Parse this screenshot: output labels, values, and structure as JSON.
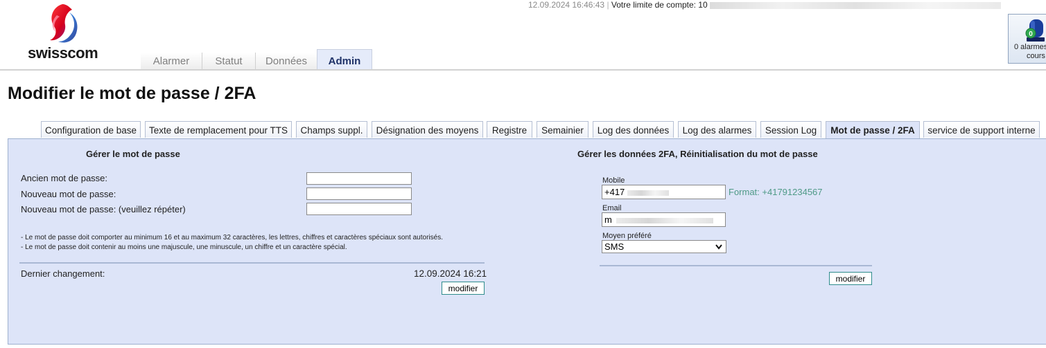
{
  "brand": {
    "name": "swisscom",
    "colors": {
      "red": "#e4003a",
      "blue": "#1f5eb5",
      "accent": "#1f3268"
    }
  },
  "topbar": {
    "datetime": "12.09.2024 16:46:43",
    "limit_label": "Votre limite de compte: 10"
  },
  "alarm_widget": {
    "count": "0",
    "label_line1": "0 alarmes",
    "label_line2": "cours",
    "icon": "alarm-beacon-icon"
  },
  "main_tabs": [
    {
      "label": "Alarmer"
    },
    {
      "label": "Statut"
    },
    {
      "label": "Données"
    },
    {
      "label": "Admin"
    }
  ],
  "active_main_tab": "Admin",
  "page_title": "Modifier le mot de passe / 2FA",
  "sub_tabs": [
    {
      "label": "Configuration de base"
    },
    {
      "label": "Texte de remplacement pour TTS"
    },
    {
      "label": "Champs suppl."
    },
    {
      "label": "Désignation des moyens"
    },
    {
      "label": "Registre"
    },
    {
      "label": "Semainier"
    },
    {
      "label": "Log des données"
    },
    {
      "label": "Log des alarmes"
    },
    {
      "label": "Session Log"
    },
    {
      "label": "Mot de passe / 2FA"
    },
    {
      "label": "service de support interne"
    }
  ],
  "active_sub_tab": "Mot de passe / 2FA",
  "password_section": {
    "title": "Gérer le mot de passe",
    "old_password_label": "Ancien mot de passe:",
    "new_password_label": "Nouveau mot de passe:",
    "repeat_password_label": "Nouveau mot de passe: (veuillez répéter)",
    "rule_1": "- Le mot de passe doit comporter au minimum 16 et au maximum 32 caractères, les lettres, chiffres et caractères spéciaux sont autorisés.",
    "rule_2": "- Le mot de passe doit contenir au moins une majuscule, une minuscule, un chiffre et un caractère spécial.",
    "last_change_label": "Dernier changement:",
    "last_change_value": "12.09.2024 16:21",
    "button_label": "modifier"
  },
  "twofa_section": {
    "title": "Gérer les données 2FA, Réinitialisation du mot de passe",
    "mobile_label": "Mobile",
    "mobile_value": "+417",
    "mobile_format_hint": "Format: +41791234567",
    "email_label": "Email",
    "email_value": "m",
    "preferred_label": "Moyen préféré",
    "preferred_value": "SMS",
    "button_label": "modifier"
  }
}
